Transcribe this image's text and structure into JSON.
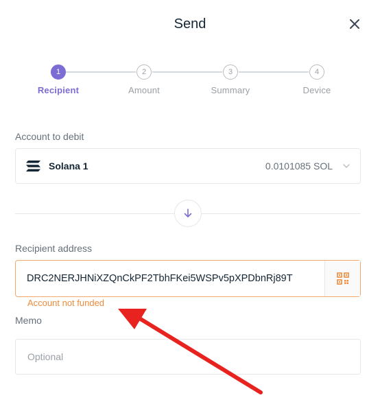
{
  "header": {
    "title": "Send",
    "close_icon": "close-icon"
  },
  "stepper": {
    "steps": [
      {
        "number": "1",
        "label": "Recipient",
        "active": true
      },
      {
        "number": "2",
        "label": "Amount",
        "active": false
      },
      {
        "number": "3",
        "label": "Summary",
        "active": false
      },
      {
        "number": "4",
        "label": "Device",
        "active": false
      }
    ]
  },
  "account": {
    "label": "Account to debit",
    "name": "Solana 1",
    "balance": "0.0101085 SOL",
    "icon": "solana-icon"
  },
  "recipient": {
    "label": "Recipient address",
    "value": "DRC2NERJHNiXZQnCkPF2TbhFKei5WSPv5pXPDbnRj89T",
    "error": "Account not funded",
    "qr_icon": "qr-code-icon"
  },
  "memo": {
    "label": "Memo",
    "placeholder": "Optional"
  },
  "colors": {
    "accent": "#7c6dd4",
    "warning": "#ee8b3a",
    "annotation_arrow": "#e8231f"
  }
}
